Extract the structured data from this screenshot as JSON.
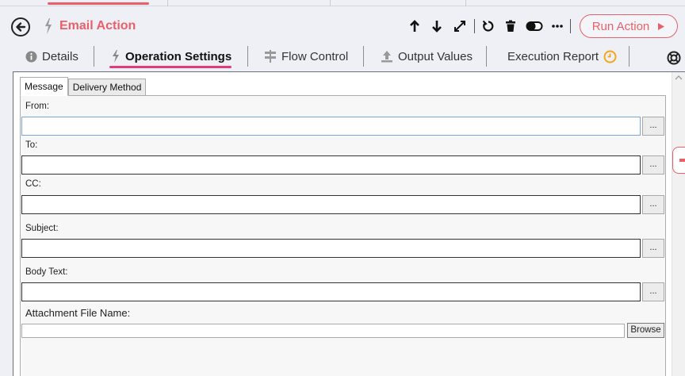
{
  "header": {
    "title": "Email Action",
    "run_label": "Run Action"
  },
  "nav": {
    "tabs": [
      {
        "label": "Details"
      },
      {
        "label": "Operation Settings"
      },
      {
        "label": "Flow Control"
      },
      {
        "label": "Output Values"
      },
      {
        "label": "Execution Report"
      }
    ]
  },
  "inner_tabs": [
    "Message",
    "Delivery Method"
  ],
  "form": {
    "from_label": "From:",
    "from_value": "",
    "to_label": "To:",
    "to_value": "",
    "cc_label": "CC:",
    "cc_value": "",
    "subject_label": "Subject:",
    "subject_value": "",
    "body_label": "Body Text:",
    "body_value": "",
    "attachment_label": "Attachment File Name:",
    "attachment_value": "",
    "ellipsis_label": "...",
    "browse_label": "Browse"
  },
  "colors": {
    "accent": "#e9606a",
    "active_underline": "#e23b7a",
    "clock": "#f3a51c"
  },
  "icons": [
    "back-arrow-icon",
    "bolt-icon",
    "arrow-up-icon",
    "arrow-down-icon",
    "expand-icon",
    "undo-icon",
    "trash-icon",
    "toggle-icon",
    "more-icon",
    "play-icon",
    "info-icon",
    "flow-icon",
    "upload-icon",
    "clock-icon",
    "help-ring-icon"
  ]
}
